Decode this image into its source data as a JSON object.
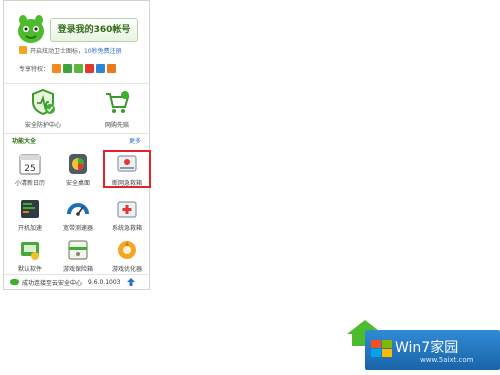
{
  "header": {
    "login_label": "登录我的360帐号",
    "promo_text": "开启炫动卫士图标，",
    "promo_link": "10秒免费注册",
    "privilege_label": "专享特权："
  },
  "top_items": [
    {
      "label": "安全防护中心",
      "icon": "shield-monitor-icon"
    },
    {
      "label": "网购先赔",
      "icon": "shopping-cart-icon"
    }
  ],
  "section": {
    "title": "功能大全",
    "more": "更多"
  },
  "tools": [
    {
      "label": "小清新日历",
      "icon": "calendar-icon",
      "day": "25"
    },
    {
      "label": "安全桌面",
      "icon": "desktop-icon"
    },
    {
      "label": "断网急救箱",
      "icon": "network-rescue-icon",
      "highlighted": true
    },
    {
      "label": "开机加速",
      "icon": "boot-speedup-icon"
    },
    {
      "label": "宽带测速器",
      "icon": "speedometer-icon"
    },
    {
      "label": "系统急救箱",
      "icon": "system-rescue-icon"
    },
    {
      "label": "默认软件",
      "icon": "default-software-icon"
    },
    {
      "label": "游戏保险箱",
      "icon": "game-safe-icon"
    },
    {
      "label": "游戏优化器",
      "icon": "game-optimizer-icon"
    }
  ],
  "status": {
    "text": "成功连接至云安全中心",
    "version": "9.6.0.1003"
  },
  "watermark": {
    "text": "Win7家园",
    "url": "www.5aixt.com"
  },
  "colors": {
    "accent_green": "#3fae2a",
    "highlight_red": "#e0242b",
    "link_blue": "#2a6fc9"
  }
}
